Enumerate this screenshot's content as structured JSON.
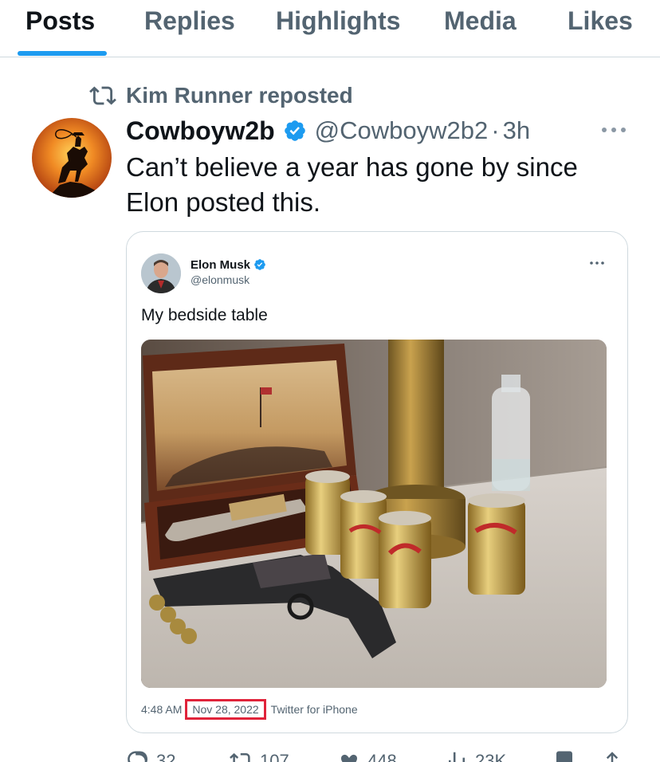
{
  "tabs": [
    {
      "label": "Posts",
      "active": true
    },
    {
      "label": "Replies",
      "active": false
    },
    {
      "label": "Highlights",
      "active": false
    },
    {
      "label": "Media",
      "active": false
    },
    {
      "label": "Likes",
      "active": false
    }
  ],
  "repost": {
    "icon": "repost-icon",
    "text": "Kim Runner reposted"
  },
  "post": {
    "author_name": "Cowboyw2b",
    "verified": true,
    "handle": "@Cowboyw2b2",
    "separator": "·",
    "time": "3h",
    "text": "Can’t believe a year has gone by since Elon posted this.",
    "more_icon": "more-icon"
  },
  "quoted": {
    "author_name": "Elon Musk",
    "verified": true,
    "handle": "@elonmusk",
    "text": "My bedside table",
    "time": "4:48 AM",
    "date": "Nov 28, 2022",
    "client": "Twitter for iPhone",
    "more_icon": "more-icon"
  },
  "actions": {
    "replies": "32",
    "reposts": "107",
    "likes": "448",
    "views": "23K"
  },
  "colors": {
    "accent": "#1d9bf0",
    "text": "#0f1419",
    "secondary": "#536471",
    "border": "#cfd9de",
    "highlight_box": "#e0233a"
  }
}
